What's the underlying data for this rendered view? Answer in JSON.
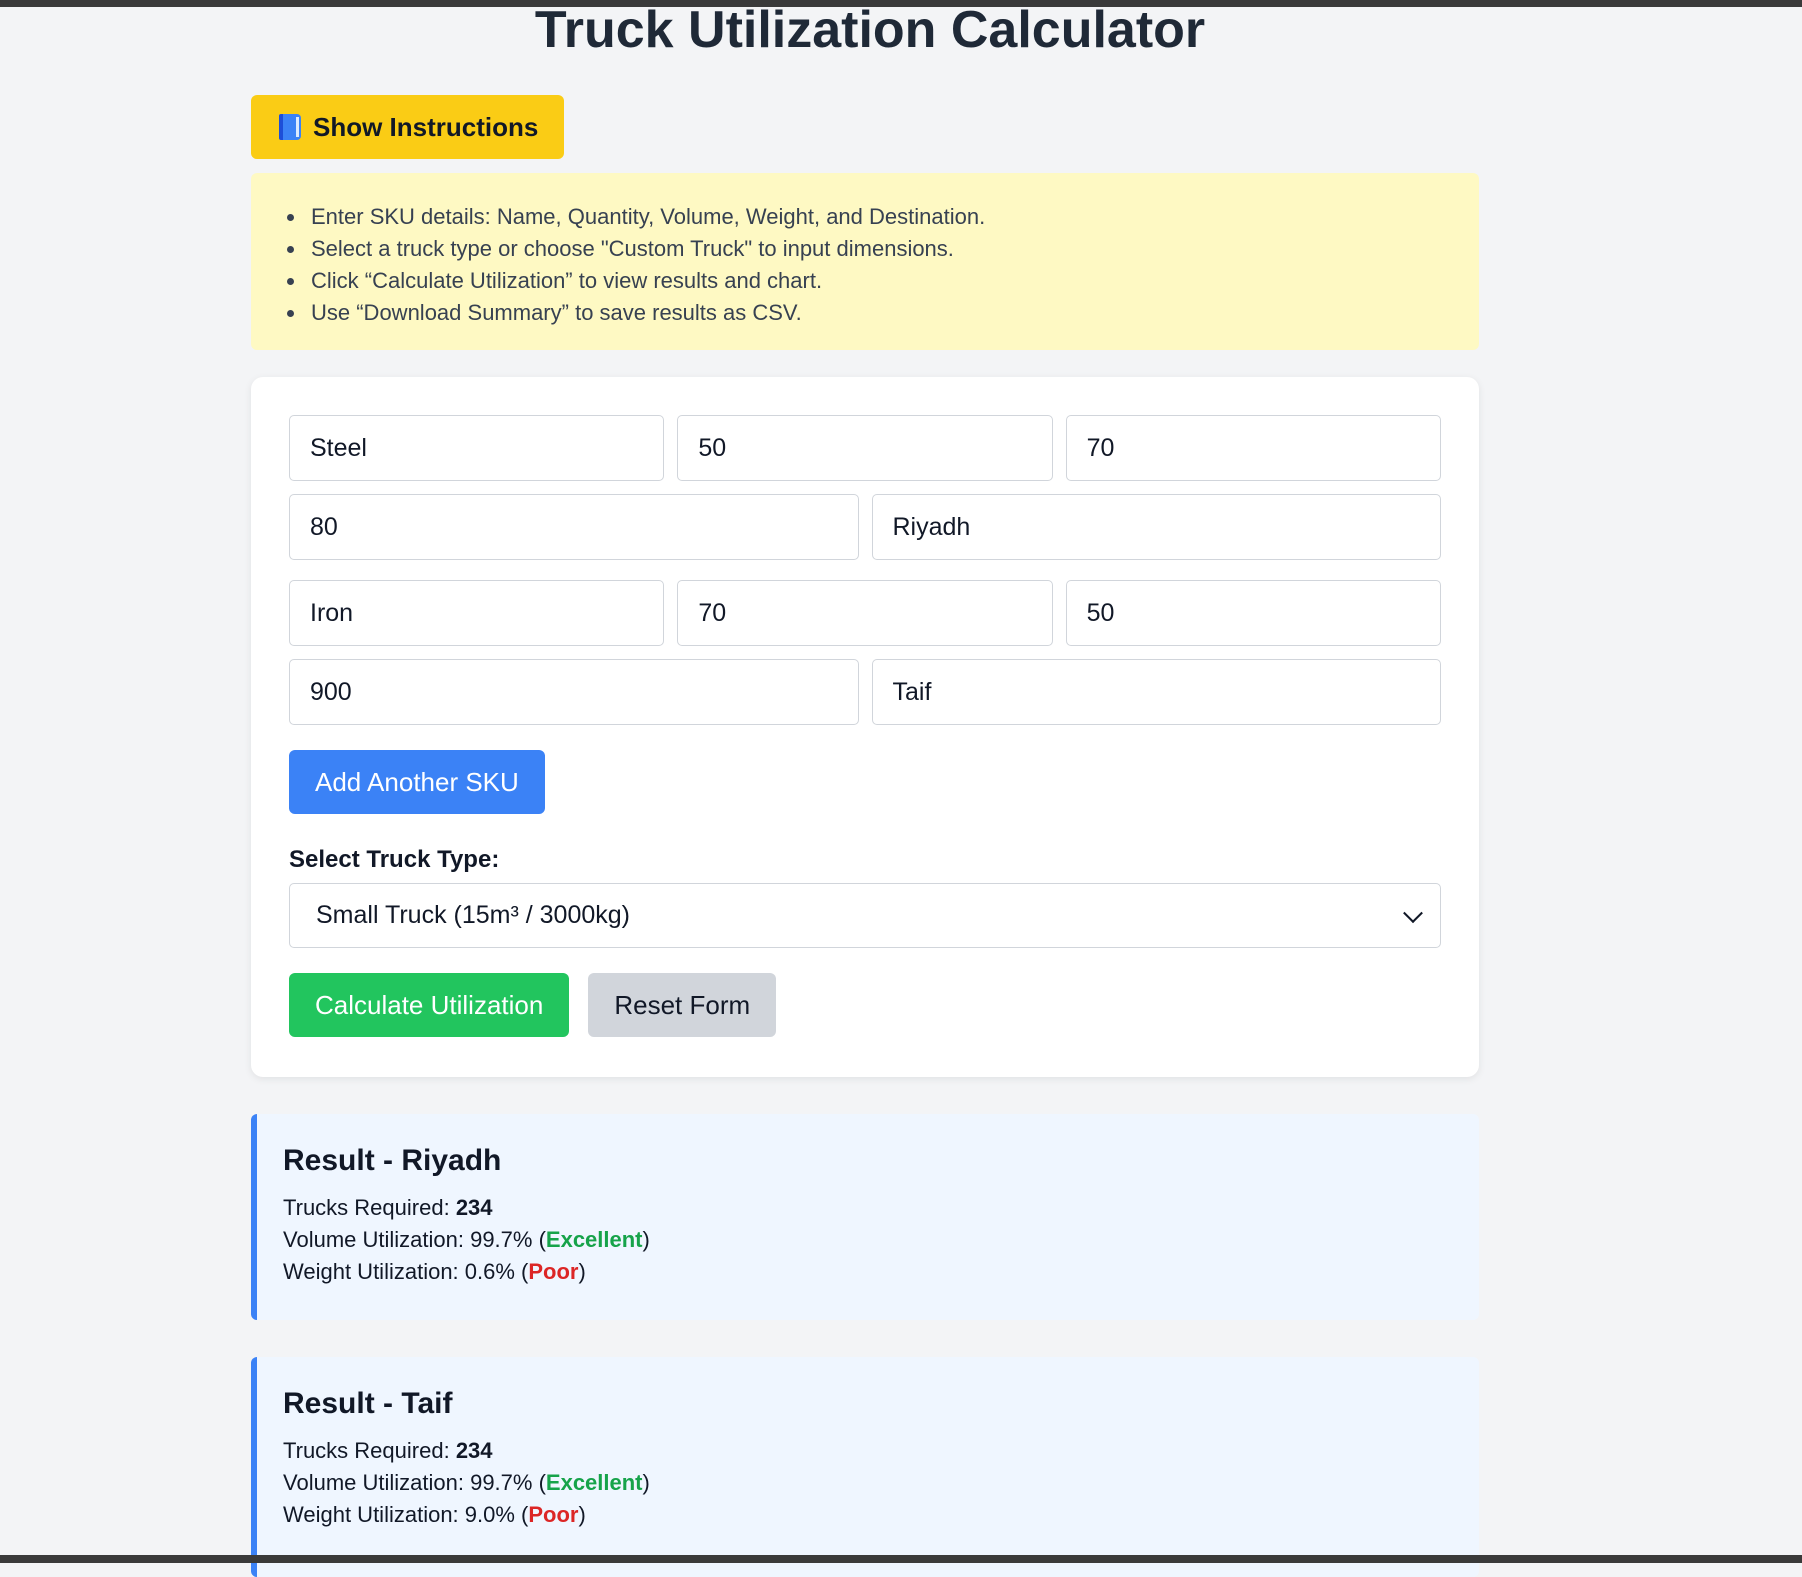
{
  "page": {
    "title": "Truck Utilization Calculator"
  },
  "instructions": {
    "button_label": "Show Instructions",
    "items": [
      "Enter SKU details: Name, Quantity, Volume, Weight, and Destination.",
      "Select a truck type or choose \"Custom Truck\" to input dimensions.",
      "Click “Calculate Utilization” to view results and chart.",
      "Use “Download Summary” to save results as CSV."
    ]
  },
  "skus": [
    {
      "name": "Steel",
      "quantity": "50",
      "volume": "70",
      "weight": "80",
      "destination": "Riyadh"
    },
    {
      "name": "Iron",
      "quantity": "70",
      "volume": "50",
      "weight": "900",
      "destination": "Taif"
    }
  ],
  "form": {
    "add_sku_label": "Add Another SKU",
    "truck_type_label": "Select Truck Type:",
    "truck_type_selected": "Small Truck (15m³ / 3000kg)",
    "calculate_label": "Calculate Utilization",
    "reset_label": "Reset Form"
  },
  "results": [
    {
      "title": "Result - Riyadh",
      "trucks_label": "Trucks Required: ",
      "trucks_value": "234",
      "volume_label": "Volume Utilization: 99.7% (",
      "volume_rating": "Excellent",
      "weight_label": "Weight Utilization: 0.6% (",
      "weight_rating": "Poor",
      "close_paren": ")"
    },
    {
      "title": "Result - Taif",
      "trucks_label": "Trucks Required: ",
      "trucks_value": "234",
      "volume_label": "Volume Utilization: 99.7% (",
      "volume_rating": "Excellent",
      "weight_label": "Weight Utilization: 9.0% (",
      "weight_rating": "Poor",
      "close_paren": ")"
    }
  ],
  "colors": {
    "instructions_button": "#facc15",
    "instructions_bg": "#fef9c3",
    "primary": "#3b82f6",
    "success": "#22c55e",
    "excellent": "#16a34a",
    "poor": "#dc2626"
  },
  "icons": {
    "instructions_icon": "book-icon",
    "select_icon": "chevron-down-icon"
  }
}
